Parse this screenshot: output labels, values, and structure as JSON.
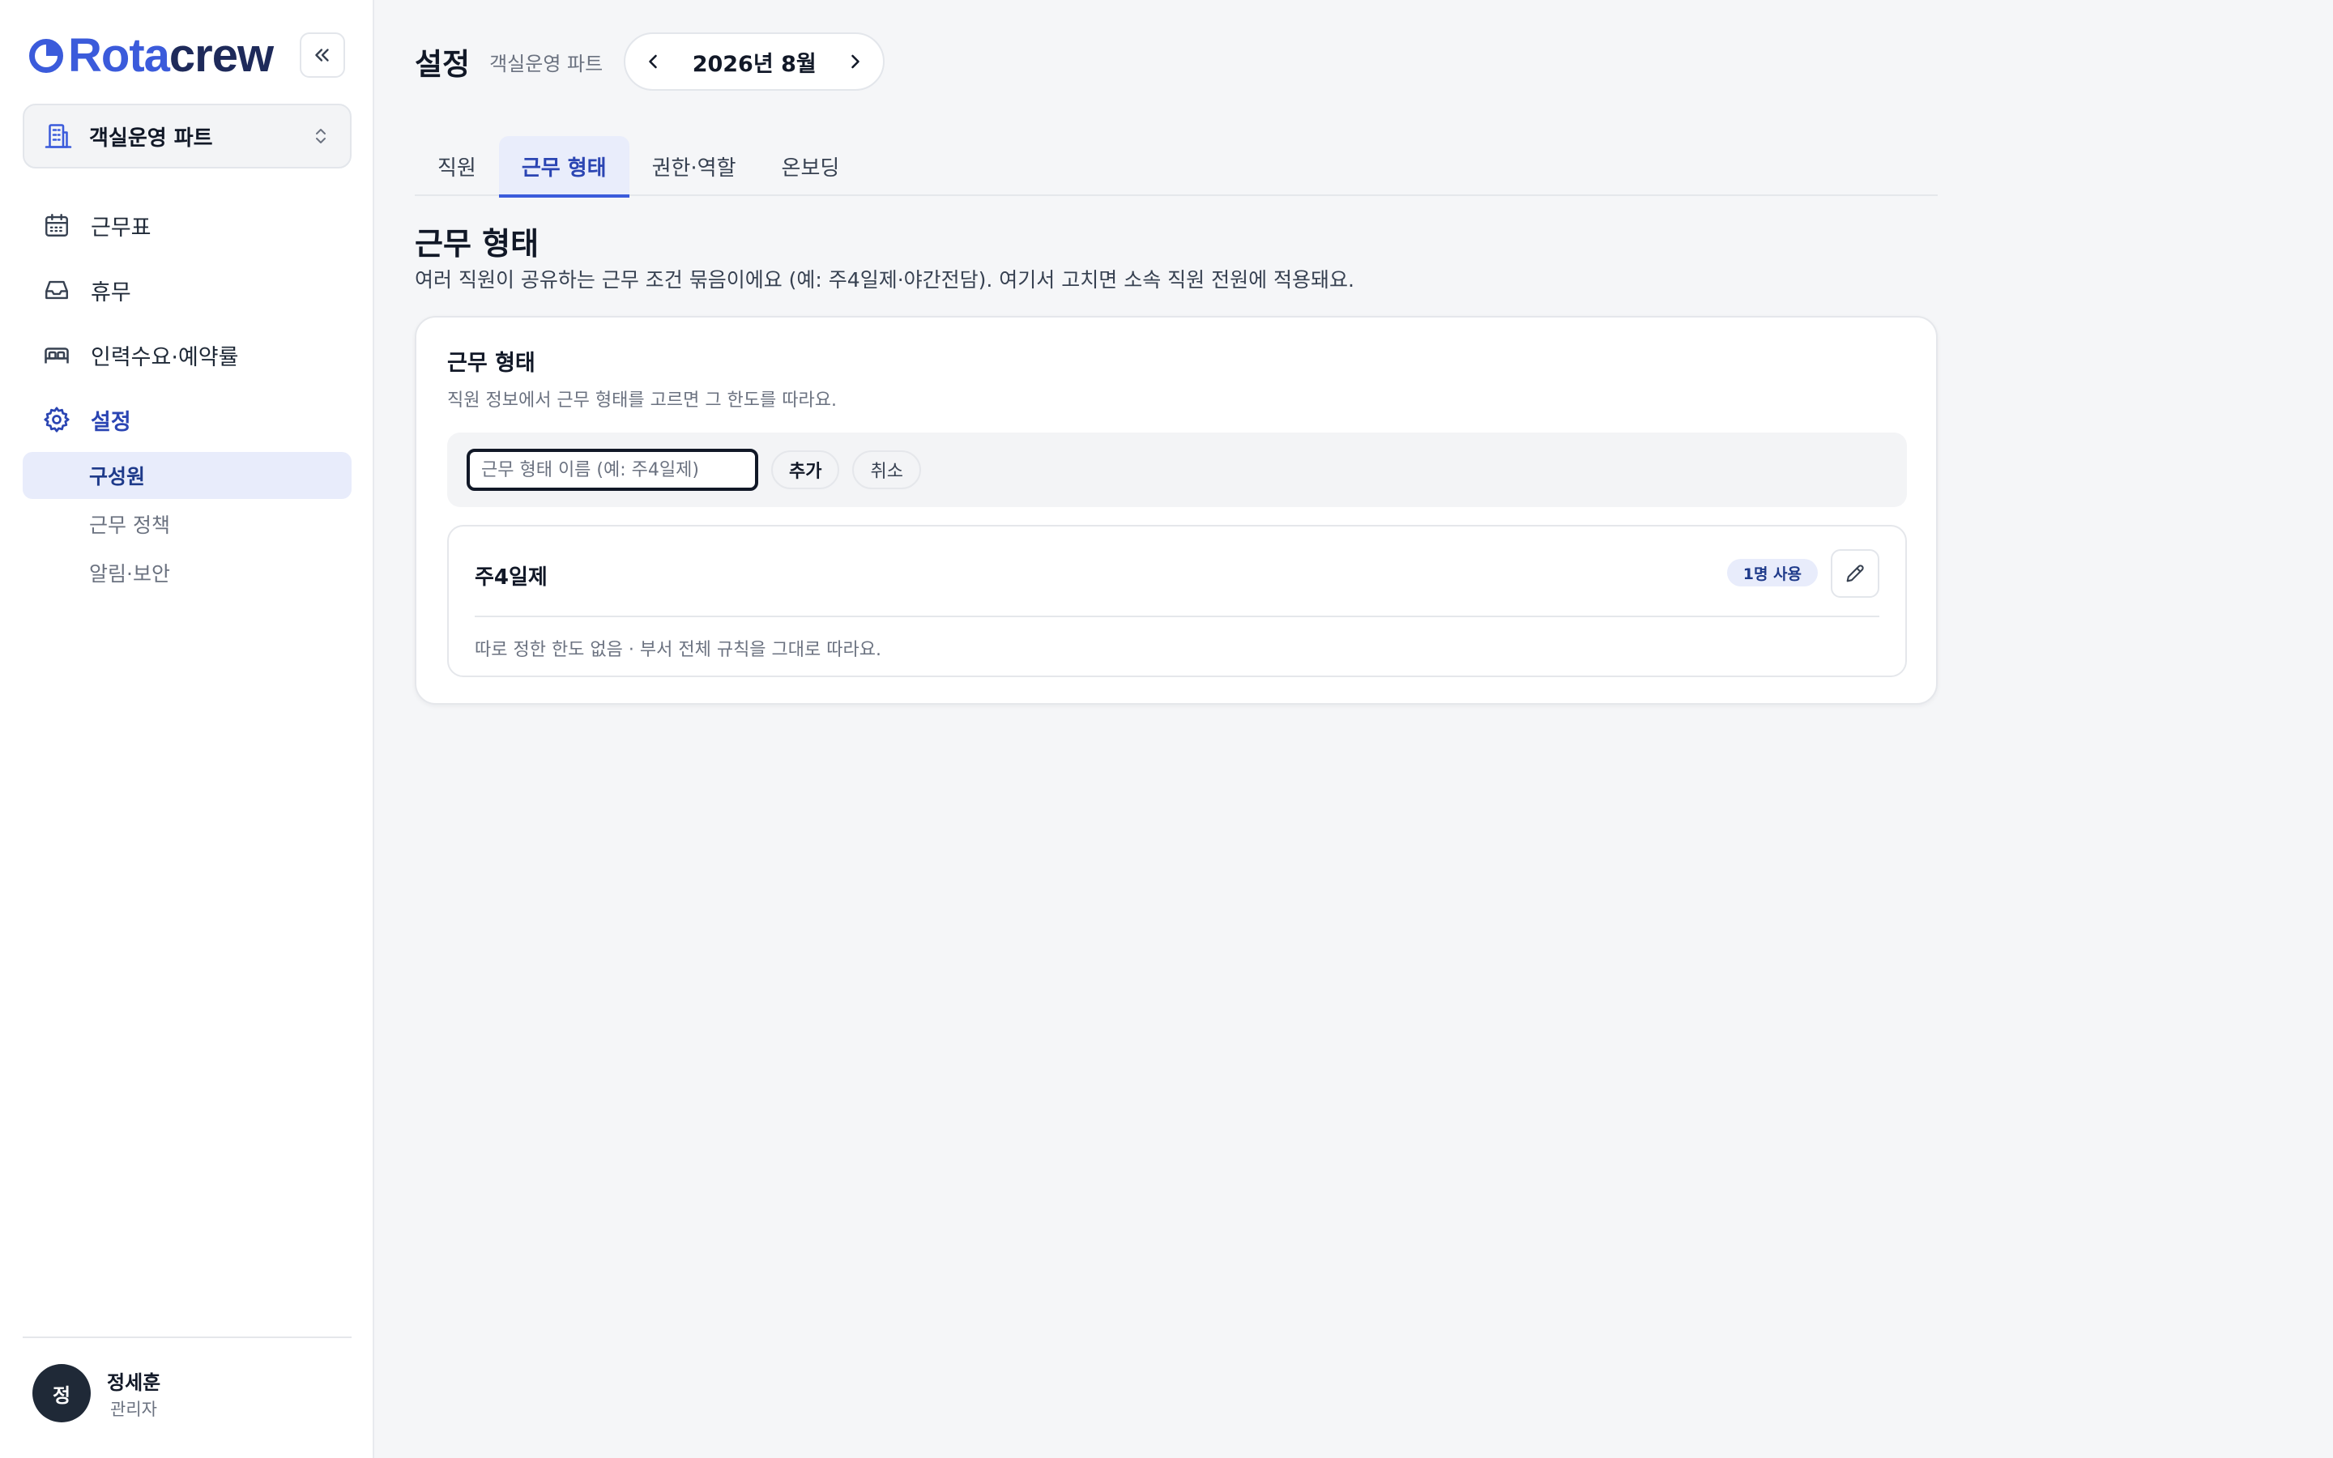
{
  "brand": {
    "name_part1": "Rota",
    "name_part2": "crew",
    "accent": "#3b5bdb",
    "dark": "#1e2a5a"
  },
  "sidebar": {
    "department": "객실운영 파트",
    "nav": [
      {
        "label": "근무표",
        "icon": "calendar-icon"
      },
      {
        "label": "휴무",
        "icon": "inbox-icon"
      },
      {
        "label": "인력수요·예약률",
        "icon": "bed-icon"
      },
      {
        "label": "설정",
        "icon": "gear-icon",
        "active": true
      }
    ],
    "sub_items": [
      {
        "label": "구성원",
        "active": true
      },
      {
        "label": "근무 정책"
      },
      {
        "label": "알림·보안"
      }
    ],
    "user": {
      "initial": "정",
      "name": "정세훈",
      "role": "관리자"
    }
  },
  "header": {
    "title": "설정",
    "subtitle": "객실운영 파트",
    "month": "2026년 8월"
  },
  "tabs": [
    {
      "label": "직원"
    },
    {
      "label": "근무 형태",
      "active": true
    },
    {
      "label": "권한·역할"
    },
    {
      "label": "온보딩"
    }
  ],
  "section": {
    "title": "근무 형태",
    "description": "여러 직원이 공유하는 근무 조건 묶음이에요 (예: 주4일제·야간전담). 여기서 고치면 소속 직원 전원에 적용돼요."
  },
  "card": {
    "title": "근무 형태",
    "description": "직원 정보에서 근무 형태를 고르면 그 한도를 따라요.",
    "input_value": "",
    "input_placeholder": "근무 형태 이름 (예: 주4일제)",
    "add_label": "추가",
    "cancel_label": "취소",
    "items": [
      {
        "name": "주4일제",
        "badge": "1명 사용",
        "note": "따로 정한 한도 없음 · 부서 전체 규칙을 그대로 따라요."
      }
    ]
  }
}
